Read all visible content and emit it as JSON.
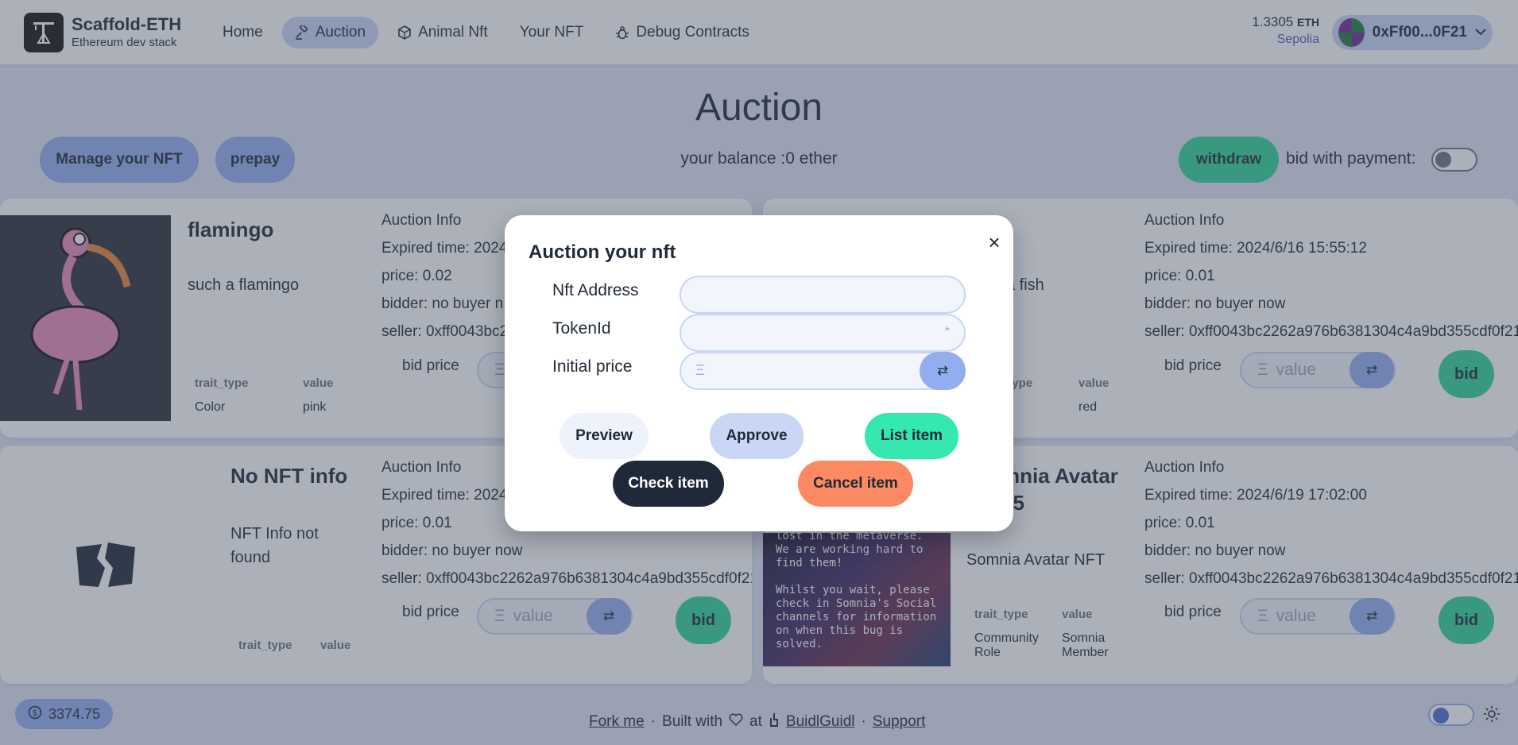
{
  "header": {
    "brand_title": "Scaffold-ETH",
    "brand_subtitle": "Ethereum dev stack",
    "nav": [
      {
        "label": "Home",
        "icon": "none"
      },
      {
        "label": "Auction",
        "icon": "gavel-icon"
      },
      {
        "label": "Animal Nft",
        "icon": "cube-icon"
      },
      {
        "label": "Your NFT",
        "icon": "none"
      },
      {
        "label": "Debug Contracts",
        "icon": "bug-icon"
      }
    ],
    "active_nav": "Auction",
    "balance_value": "1.3305",
    "balance_unit": "ETH",
    "network": "Sepolia",
    "wallet_address": "0xFf00...0F21"
  },
  "main": {
    "title": "Auction",
    "manage_button": "Manage your NFT",
    "prepay_button": "prepay",
    "balance_text": "your balance :0 ether",
    "withdraw_button": "withdraw",
    "bid_with_payment_label": "bid with payment:"
  },
  "cards": [
    {
      "name": "flamingo",
      "description": "such a flamingo",
      "trait_header": [
        "trait_type",
        "value"
      ],
      "traits": [
        {
          "type": "Color",
          "value": "pink"
        }
      ],
      "auction_info_title": "Auction Info",
      "expired": "Expired time: 2024",
      "price": "price: 0.02",
      "bidder": "bidder: no buyer n",
      "seller": "seller: 0xff0043bc2",
      "bid_price_label": "bid price",
      "bid_placeholder": "Ξ"
    },
    {
      "name": "n",
      "description": "a fish",
      "trait_header": [
        "_type",
        "value"
      ],
      "traits": [
        {
          "type": "or",
          "value": "red"
        }
      ],
      "auction_info_title": "Auction Info",
      "expired": "Expired time: 2024/6/16 15:55:12",
      "price": "price: 0.01",
      "bidder": "bidder: no buyer now",
      "seller": "seller: 0xff0043bc2262a976b6381304c4a9bd355cdf0f21",
      "bid_price_label": "bid price",
      "bid_placeholder": "value",
      "bid_button": "bid"
    },
    {
      "name": "No NFT info",
      "description": "NFT Info not found",
      "trait_header": [
        "trait_type",
        "value"
      ],
      "auction_info_title": "Auction Info",
      "expired": "Expired time: 2024",
      "price": "price: 0.01",
      "bidder": "bidder: no buyer now",
      "seller": "seller: 0xff0043bc2262a976b6381304c4a9bd355cdf0f21",
      "bid_price_label": "bid price",
      "bid_placeholder": "value",
      "bid_button": "bid"
    },
    {
      "name": "mnia Avatar",
      "name_line2": "35",
      "description": "Somnia Avatar NFT",
      "image_text": "lost in the metaverse.\nWe are working hard to find them!\n\nWhilst you wait, please check in Somnia's Social channels for information on when this bug is solved.",
      "trait_header": [
        "trait_type",
        "value"
      ],
      "traits": [
        {
          "type": "Community Role",
          "value": "Somnia Member"
        }
      ],
      "auction_info_title": "Auction Info",
      "expired": "Expired time: 2024/6/19 17:02:00",
      "price": "price: 0.01",
      "bidder": "bidder: no buyer now",
      "seller": "seller: 0xff0043bc2262a976b6381304c4a9bd355cdf0f21",
      "bid_price_label": "bid price",
      "bid_placeholder": "value",
      "bid_button": "bid"
    }
  ],
  "footer": {
    "eth_price": "3374.75",
    "fork_me": "Fork me",
    "built_with": "Built with",
    "at": "at",
    "buidlguidl": "BuidlGuidl",
    "support": "Support",
    "separator": "·"
  },
  "modal": {
    "title": "Auction your nft",
    "close_label": "×",
    "nft_address_label": "Nft Address",
    "nft_address_value": "",
    "token_id_label": "TokenId",
    "token_id_value": "",
    "token_id_suffix": "*",
    "initial_price_label": "Initial price",
    "initial_price_prefix": "Ξ",
    "buttons": {
      "preview": "Preview",
      "approve": "Approve",
      "list_item": "List item",
      "check_item": "Check item",
      "cancel_item": "Cancel item"
    }
  },
  "colors": {
    "accent_blue": "#93aef0",
    "accent_green": "#2ed398",
    "cancel_orange": "#fb8a63",
    "dark": "#1f2937"
  }
}
